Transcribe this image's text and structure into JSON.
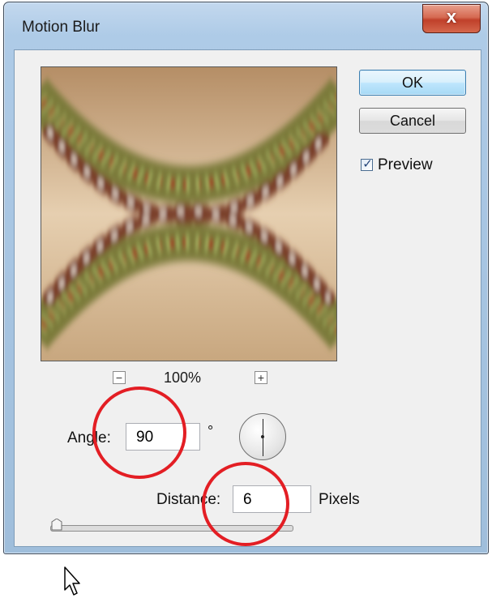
{
  "window": {
    "title": "Motion Blur",
    "close_glyph": "x"
  },
  "preview": {
    "zoom_level": "100%",
    "zoom_out_glyph": "−",
    "zoom_in_glyph": "+"
  },
  "buttons": {
    "ok_label": "OK",
    "cancel_label": "Cancel"
  },
  "preview_checkbox": {
    "label": "Preview",
    "checked": true,
    "check_glyph": "✓"
  },
  "angle": {
    "label": "Angle:",
    "value": "90",
    "unit": "°"
  },
  "distance": {
    "label": "Distance:",
    "value": "6",
    "unit": "Pixels"
  },
  "colors": {
    "annotation": "#e31e24",
    "ok_accent": "#3c7fb1"
  },
  "icons": {
    "close": "close-icon",
    "zoom_out": "zoom-out-icon",
    "zoom_in": "zoom-in-icon",
    "angle_dial": "angle-dial-icon",
    "cursor": "mouse-cursor-icon"
  }
}
